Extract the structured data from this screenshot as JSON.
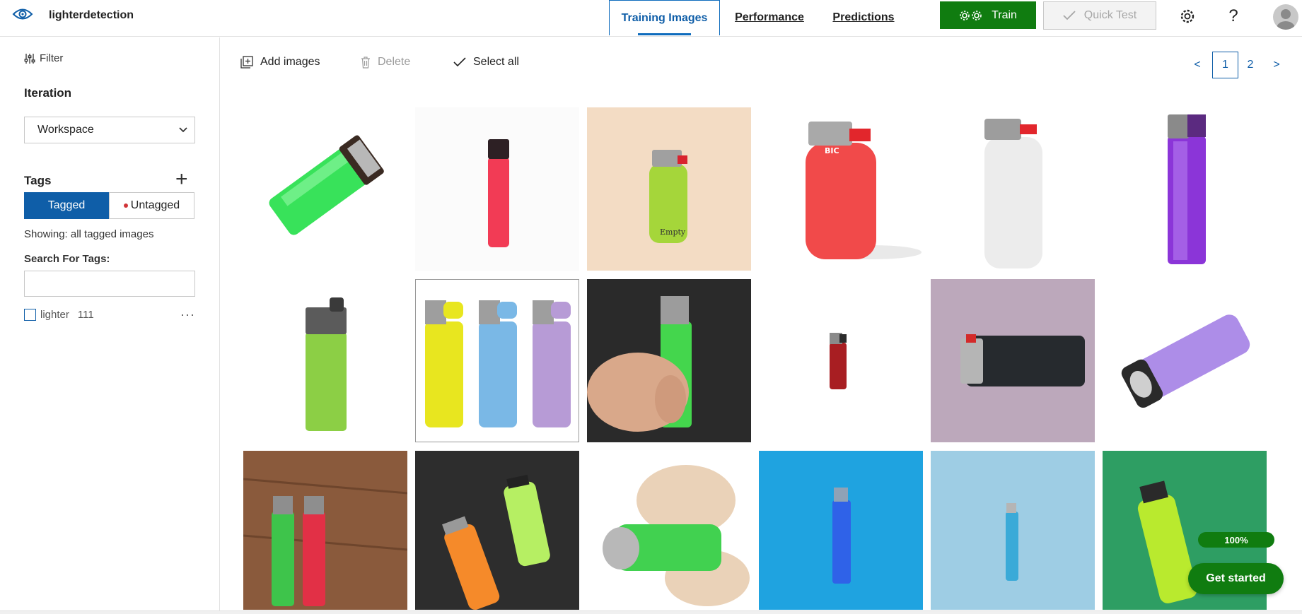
{
  "app": {
    "title": "lighterdetection"
  },
  "nav": {
    "tabs": [
      {
        "label": "Training Images",
        "active": true
      },
      {
        "label": "Performance",
        "active": false
      },
      {
        "label": "Predictions",
        "active": false
      }
    ],
    "train_label": "Train",
    "quick_test_label": "Quick Test"
  },
  "sidebar": {
    "filter_label": "Filter",
    "iteration_heading": "Iteration",
    "iteration_value": "Workspace",
    "tags_heading": "Tags",
    "tagged_label": "Tagged",
    "untagged_label": "Untagged",
    "showing_text": "Showing: all tagged images",
    "search_label": "Search For Tags:",
    "search_value": "",
    "tags": [
      {
        "name": "lighter",
        "count": "111"
      }
    ]
  },
  "toolbar": {
    "add_images_label": "Add images",
    "delete_label": "Delete",
    "select_all_label": "Select all"
  },
  "pagination": {
    "prev": "<",
    "pages": [
      "1",
      "2"
    ],
    "current": "1",
    "next": ">"
  },
  "colors": {
    "accent_blue": "#0f5ea8",
    "train_green": "#107c10",
    "untagged_dot": "#d13438"
  },
  "images": [
    {
      "bg": "#ffffff",
      "subject": "green translucent lighter lying diagonally"
    },
    {
      "bg": "#fbfbfb",
      "subject": "red lighter"
    },
    {
      "bg": "#f3dcc4",
      "subject": "lime-green BIC lighter"
    },
    {
      "bg": "#ffffff",
      "subject": "red BIC lighter"
    },
    {
      "bg": "#ffffff",
      "subject": "white lighter"
    },
    {
      "bg": "#ffffff",
      "subject": "purple translucent lighter"
    },
    {
      "bg": "#ffffff",
      "subject": "light green lighter"
    },
    {
      "bg": "#ffffff",
      "subject": "yellow, blue and lilac lighters",
      "selected": true
    },
    {
      "bg": "#2a2a2a",
      "subject": "hand holding green lighter"
    },
    {
      "bg": "#ffffff",
      "subject": "small dark red lighter"
    },
    {
      "bg": "#bca8bb",
      "subject": "black lighter on pink surface"
    },
    {
      "bg": "#ffffff",
      "subject": "lavender lighter lying diagonally"
    },
    {
      "bg": "#8a5a3c",
      "subject": "green and red lighters on wood"
    },
    {
      "bg": "#2d2d2d",
      "subject": "orange and lime lighters on dark background"
    },
    {
      "bg": "#ffffff",
      "subject": "wooden hand holding green lighter"
    },
    {
      "bg": "#1fa3e0",
      "subject": "blue lighter on blue background"
    },
    {
      "bg": "#9ecde4",
      "subject": "blue lighter on light blue background"
    },
    {
      "bg": "#2e9e63",
      "subject": "lime lighter on green background"
    }
  ],
  "float": {
    "progress": "100%",
    "get_started_label": "Get started"
  }
}
